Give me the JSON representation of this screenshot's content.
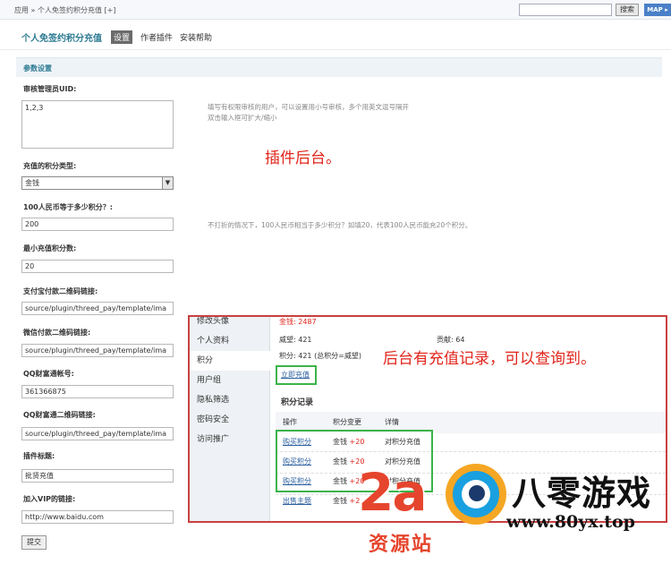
{
  "topbar": {
    "breadcrumb": "应用 » 个人免签约积分充值 [+]",
    "search_button": "搜索",
    "map_button": "MAP ▸"
  },
  "header": {
    "plugin_title": "个人免签约积分充值",
    "tabs": [
      {
        "label": "设置",
        "active": true
      },
      {
        "label": "作者插件",
        "active": false
      },
      {
        "label": "安装帮助",
        "active": false
      }
    ]
  },
  "section_title": "参数设置",
  "form": {
    "admin_uid": {
      "label": "审核管理员UID:",
      "value": "1,2,3",
      "hint_line1": "填写有权限审核的用户，可以设置用小号审核，多个用英文逗号隔开",
      "hint_line2": "双击输入框可扩大/缩小"
    },
    "credit_type": {
      "label": "充值的积分类型:",
      "value": "金钱"
    },
    "rmb_ratio": {
      "label": "100人民币等于多少积分？:",
      "value": "200",
      "hint": "不打折的情况下，100人民币相当于多少积分？如填20，代表100人民币能充20个积分。"
    },
    "min_amount": {
      "label": "最小充值积分数:",
      "value": "20"
    },
    "alipay_qr": {
      "label": "支付宝付款二维码链接:",
      "value": "source/plugin/threed_pay/template/ima"
    },
    "wechat_qr": {
      "label": "微信付款二维码链接:",
      "value": "source/plugin/threed_pay/template/ima"
    },
    "qq_account": {
      "label": "QQ财富通帐号:",
      "value": "361366875"
    },
    "qq_qr": {
      "label": "QQ财富通二维码链接:",
      "value": "source/plugin/threed_pay/template/ima"
    },
    "plugin_title": {
      "label": "插件标题:",
      "value": "批贤充值"
    },
    "vip_link": {
      "label": "加入VIP的链接:",
      "value": "http://www.baidu.com"
    },
    "submit": "提交"
  },
  "annotations": {
    "backend": "插件后台。",
    "records": "后台有充值记录，可以查询到。"
  },
  "panel": {
    "nav": [
      "修改头像",
      "个人资料",
      "积分",
      "用户组",
      "隐私筛选",
      "密码安全",
      "访问推广"
    ],
    "active_nav": "积分",
    "money_label": "金钱:",
    "money_value": "2487",
    "prestige": "威望: 421",
    "contribution": "贡献: 64",
    "credits_label": "积分:",
    "credits_value": "421 (总积分=威望)",
    "recharge_link": "立即充值",
    "records_title": "积分记录",
    "columns": [
      "操作",
      "积分变更",
      "详情"
    ],
    "rows": [
      {
        "op": "购买积分",
        "type": "金钱",
        "delta": "+20",
        "detail": "对积分充值"
      },
      {
        "op": "购买积分",
        "type": "金钱",
        "delta": "+20",
        "detail": "对积分充值"
      },
      {
        "op": "购买积分",
        "type": "金钱",
        "delta": "+20",
        "detail": "对积分充值"
      },
      {
        "op": "出售主题",
        "type": "金钱",
        "delta": "+2",
        "detail": ""
      }
    ]
  },
  "watermark": {
    "logo_text": "2a",
    "sub_text": "资源站",
    "site_name": "八零游戏",
    "url": "www.80yx.top"
  },
  "colors": {
    "accent": "#2d7b92",
    "annotation_red": "#e1251b",
    "highlight_green": "#3bb34a",
    "panel_border": "#c84040"
  }
}
